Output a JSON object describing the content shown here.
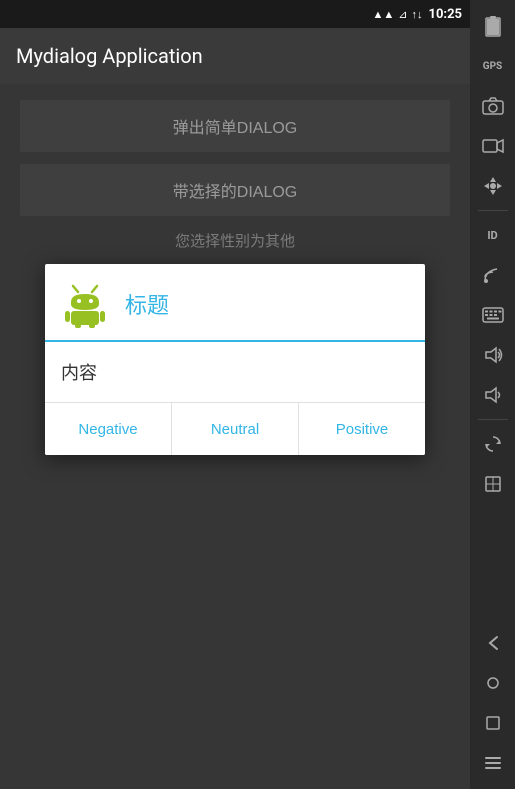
{
  "statusBar": {
    "time": "10:25"
  },
  "appBar": {
    "title": "Mydialog Application"
  },
  "mainContent": {
    "button1": "弹出简单DIALOG",
    "button2": "带选择的DIALOG",
    "selectedText": "您选择性别为其他"
  },
  "dialog": {
    "title": "标题",
    "content": "内容",
    "negativeButton": "Negative",
    "neutralButton": "Neutral",
    "positiveButton": "Positive"
  },
  "sidebar": {
    "icons": [
      {
        "name": "battery-icon",
        "symbol": "🔋"
      },
      {
        "name": "gps-icon",
        "symbol": "⊕"
      },
      {
        "name": "camera-icon",
        "symbol": "◉"
      },
      {
        "name": "video-icon",
        "symbol": "▶"
      },
      {
        "name": "dpad-icon",
        "symbol": "✛"
      },
      {
        "name": "id-icon",
        "symbol": "ID"
      },
      {
        "name": "rss-icon",
        "symbol": "📶"
      },
      {
        "name": "keyboard-icon",
        "symbol": "⌨"
      },
      {
        "name": "volume-up-icon",
        "symbol": "🔊"
      },
      {
        "name": "volume-down-icon",
        "symbol": "🔉"
      },
      {
        "name": "rotate-icon",
        "symbol": "⟳"
      },
      {
        "name": "scale-icon",
        "symbol": "⊡"
      }
    ]
  },
  "bottomNav": {
    "backButton": "←",
    "homeButton": "○",
    "recentButton": "□",
    "menuButton": "≡"
  }
}
